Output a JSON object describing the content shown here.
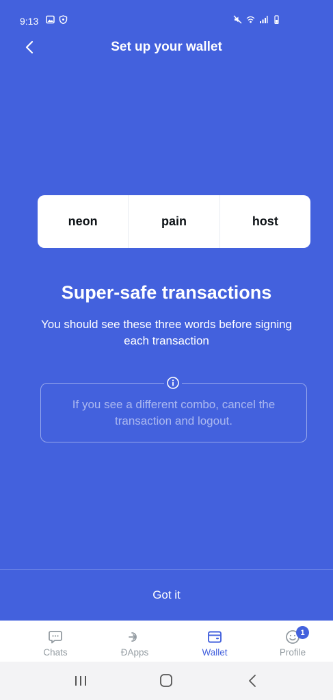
{
  "status_bar": {
    "time": "9:13",
    "left_icons": [
      "image-icon",
      "shield-icon"
    ],
    "right_icons": [
      "mute-icon",
      "wifi-icon",
      "signal-icon",
      "battery-icon"
    ]
  },
  "header": {
    "back_icon": "chevron-left-icon",
    "title": "Set up your wallet"
  },
  "words": [
    "neon",
    "pain",
    "host"
  ],
  "headline": "Super-safe transactions",
  "subtitle": "You should see these three words before signing each transaction",
  "warning": {
    "icon": "info-icon",
    "text": "If you see a different combo, cancel the transaction and logout."
  },
  "primary_button": "Got it",
  "tabs": [
    {
      "label": "Chats",
      "icon": "chat-icon",
      "active": false
    },
    {
      "label": "ÐApps",
      "icon": "dapps-icon",
      "active": false
    },
    {
      "label": "Wallet",
      "icon": "wallet-icon",
      "active": true
    },
    {
      "label": "Profile",
      "icon": "profile-icon",
      "active": false,
      "badge": "1"
    }
  ],
  "android_nav": [
    "recents-icon",
    "home-icon",
    "back-icon"
  ],
  "colors": {
    "accent": "#4361DD",
    "tab_inactive": "#939ba1",
    "word_text": "#0d1216"
  }
}
